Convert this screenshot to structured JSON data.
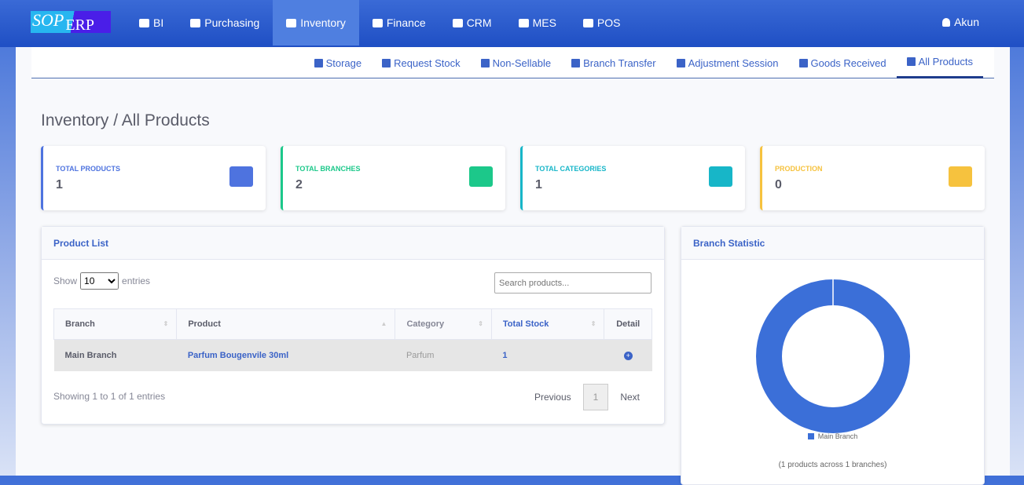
{
  "brand": {
    "part1": "SOP",
    "part2": "ERP"
  },
  "nav": [
    {
      "label": "BI",
      "icon": "gauge-icon"
    },
    {
      "label": "Purchasing",
      "icon": "store-icon"
    },
    {
      "label": "Inventory",
      "icon": "boxes-icon",
      "active": true
    },
    {
      "label": "Finance",
      "icon": "bank-icon"
    },
    {
      "label": "CRM",
      "icon": "layers-icon"
    },
    {
      "label": "MES",
      "icon": "industry-icon"
    },
    {
      "label": "POS",
      "icon": "store-icon"
    }
  ],
  "account": "Akun",
  "subnav": [
    {
      "label": "Storage"
    },
    {
      "label": "Request Stock"
    },
    {
      "label": "Non-Sellable"
    },
    {
      "label": "Branch Transfer"
    },
    {
      "label": "Adjustment Session"
    },
    {
      "label": "Goods Received"
    },
    {
      "label": "All Products",
      "active": true
    }
  ],
  "page_title": "Inventory / All Products",
  "cards": [
    {
      "label": "TOTAL PRODUCTS",
      "value": "1",
      "color": "#4e73df"
    },
    {
      "label": "TOTAL BRANCHES",
      "value": "2",
      "color": "#1cc88a"
    },
    {
      "label": "TOTAL CATEGORIES",
      "value": "1",
      "color": "#17b6c8"
    },
    {
      "label": "PRODUCTION",
      "value": "0",
      "color": "#f6c23e"
    }
  ],
  "product_list": {
    "title": "Product List",
    "show": "Show",
    "entries": "entries",
    "page_size": "10",
    "search_placeholder": "Search products...",
    "columns": [
      "Branch",
      "Product",
      "Category",
      "Total Stock",
      "Detail"
    ],
    "rows": [
      {
        "branch": "Main Branch",
        "product": "Parfum Bougenvile 30ml",
        "category": "Parfum",
        "stock": "1"
      }
    ],
    "info": "Showing 1 to 1 of 1 entries",
    "prev": "Previous",
    "page": "1",
    "next": "Next"
  },
  "branch_stat": {
    "title": "Branch Statistic",
    "caption": "(1 products across 1 branches)"
  },
  "chart_data": {
    "type": "pie",
    "variant": "doughnut",
    "categories": [
      "Main Branch"
    ],
    "values": [
      1
    ],
    "colors": [
      "#3b6fd8"
    ],
    "legend": "bottom"
  }
}
